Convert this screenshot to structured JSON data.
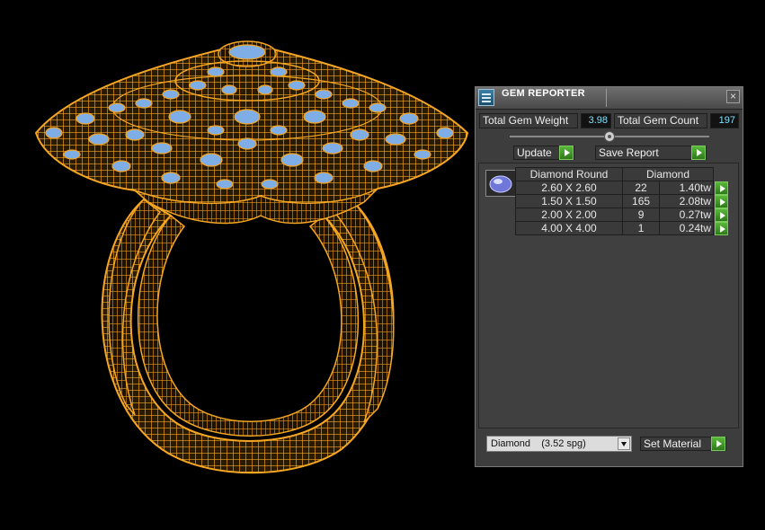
{
  "panel": {
    "title": "GEM REPORTER",
    "close_glyph": "×",
    "icon": "gem-reporter-icon"
  },
  "totals": {
    "weight_label": "Total Gem Weight",
    "weight_value": "3.98",
    "count_label": "Total Gem Count",
    "count_value": "197"
  },
  "actions": {
    "update_label": "Update",
    "save_label": "Save Report"
  },
  "table": {
    "headers": [
      "Diamond Round",
      "Diamond"
    ],
    "rows": [
      {
        "size": "2.60 X 2.60",
        "count": "22",
        "weight": "1.40tw"
      },
      {
        "size": "1.50 X 1.50",
        "count": "165",
        "weight": "2.08tw"
      },
      {
        "size": "2.00 X 2.00",
        "count": "9",
        "weight": "0.27tw"
      },
      {
        "size": "4.00 X 4.00",
        "count": "1",
        "weight": "0.24tw"
      }
    ]
  },
  "material": {
    "selected": "Diamond    (3.52 spg)",
    "set_label": "Set Material"
  },
  "colors": {
    "wireframe": "#f5a623",
    "gem_fill": "#7faee6",
    "accent_green": "#3f9a25",
    "value_text": "#7fe1ff"
  }
}
